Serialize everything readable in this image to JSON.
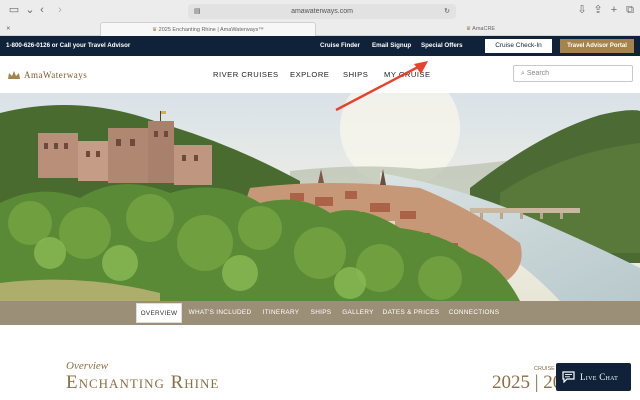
{
  "browser": {
    "url": "amawaterways.com",
    "tabs": [
      {
        "label": "2025 Enchanting Rhine | AmaWaterways™",
        "active": true
      },
      {
        "label": "AmaCRE",
        "active": false
      }
    ]
  },
  "utility_bar": {
    "phone_text": "1-800-626-0126 or Call your Travel Advisor",
    "links": [
      "Cruise Finder",
      "Email Signup",
      "Special Offers"
    ],
    "checkin_label": "Cruise Check-In",
    "portal_label": "Travel Advisor Portal"
  },
  "main_nav": {
    "logo_text": "AmaWaterways",
    "items": [
      "RIVER CRUISES",
      "EXPLORE",
      "SHIPS",
      "MY CRUISE"
    ],
    "search_placeholder": "Search"
  },
  "sub_nav": {
    "items": [
      "OVERVIEW",
      "WHAT'S INCLUDED",
      "ITINERARY",
      "SHIPS",
      "GALLERY",
      "DATES & PRICES",
      "CONNECTIONS"
    ],
    "active_index": 0
  },
  "overview": {
    "label": "Overview",
    "title": "Enchanting Rhine",
    "cruises_label": "CRUISE",
    "years": "2025 | 20"
  },
  "live_chat": {
    "label": "Live Chat"
  },
  "colors": {
    "navy": "#0f2239",
    "gold": "#a6834a",
    "taupe": "#9c8f78",
    "annotation_red": "#e8412c"
  }
}
